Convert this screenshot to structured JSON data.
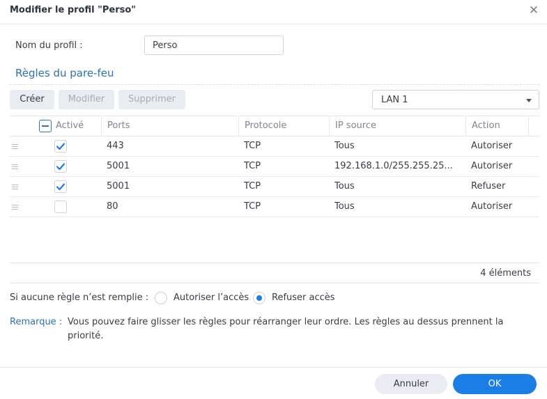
{
  "dialog": {
    "title": "Modifier le profil \"Perso\"",
    "close_icon": "close-icon"
  },
  "profile": {
    "name_label": "Nom du profil :",
    "name_value": "Perso"
  },
  "rules": {
    "section_title": "Règles du pare-feu",
    "toolbar": {
      "create_label": "Créer",
      "modify_label": "Modifier",
      "delete_label": "Supprimer"
    },
    "interface_select": "LAN 1",
    "columns": {
      "enabled": "Activé",
      "ports": "Ports",
      "protocol": "Protocole",
      "source_ip": "IP source",
      "action": "Action"
    },
    "rows": [
      {
        "enabled": true,
        "ports": "443",
        "protocol": "TCP",
        "source_ip": "Tous",
        "action": "Autoriser"
      },
      {
        "enabled": true,
        "ports": "5001",
        "protocol": "TCP",
        "source_ip": "192.168.1.0/255.255.25...",
        "action": "Autoriser"
      },
      {
        "enabled": true,
        "ports": "5001",
        "protocol": "TCP",
        "source_ip": "Tous",
        "action": "Refuser"
      },
      {
        "enabled": false,
        "ports": "80",
        "protocol": "TCP",
        "source_ip": "Tous",
        "action": "Autoriser"
      }
    ],
    "count_text": "4 éléments"
  },
  "default_policy": {
    "label": "Si aucune règle n’est remplie :",
    "options": [
      {
        "label": "Autoriser l’accès",
        "selected": false
      },
      {
        "label": "Refuser accès",
        "selected": true
      }
    ]
  },
  "note": {
    "label": "Remarque :",
    "text": "Vous pouvez faire glisser les règles pour réarranger leur ordre. Les règles au dessus prennent la priorité."
  },
  "footer": {
    "cancel_label": "Annuler",
    "ok_label": "OK"
  },
  "colors": {
    "accent": "#1a7ee6",
    "section_title": "#2a72b5"
  }
}
